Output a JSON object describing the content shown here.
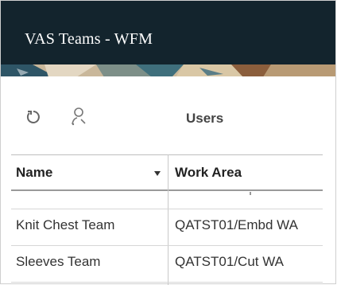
{
  "header": {
    "title": "VAS Teams - WFM"
  },
  "toolbar": {
    "refresh_icon": "refresh-icon",
    "user_search_icon": "user-search-icon",
    "users_label": "Users"
  },
  "table": {
    "columns": [
      {
        "label": "Name",
        "sort_icon": "sort-desc-icon"
      },
      {
        "label": "Work Area"
      }
    ],
    "rows": [
      {
        "name": "Knit Chest Team",
        "work_area": "QATST01/Embd WA"
      },
      {
        "name": "Sleeves Team",
        "work_area": "QATST01/Cut WA"
      }
    ]
  },
  "colors": {
    "header_bg": "#13242d",
    "title_text": "#ffffff"
  }
}
